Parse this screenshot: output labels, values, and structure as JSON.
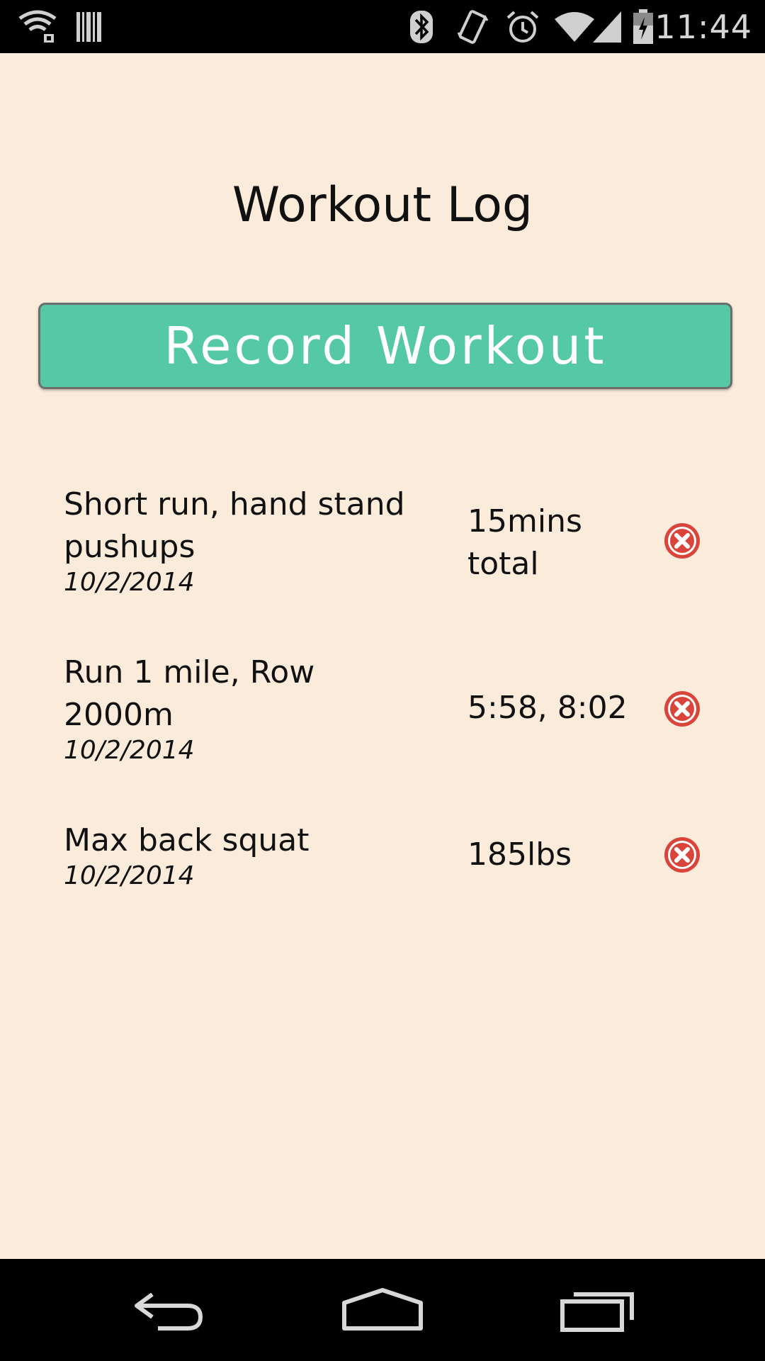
{
  "status_bar": {
    "time": "11:44",
    "icons": [
      "wifi-lock-icon",
      "barcode-icon",
      "bluetooth-icon",
      "vibrate-icon",
      "alarm-icon",
      "wifi-icon",
      "cell-signal-icon",
      "battery-icon"
    ]
  },
  "header": {
    "title": "Workout Log"
  },
  "actions": {
    "record_label": "Record Workout"
  },
  "workouts": [
    {
      "description": "Short run, hand stand pushups",
      "date": "10/2/2014",
      "result": "15mins total"
    },
    {
      "description": "Run 1 mile, Row 2000m",
      "date": "10/2/2014",
      "result": "5:58, 8:02"
    },
    {
      "description": "Max back squat",
      "date": "10/2/2014",
      "result": "185lbs"
    }
  ],
  "nav_bar": {
    "icons": [
      "back-icon",
      "home-icon",
      "recent-apps-icon"
    ]
  },
  "colors": {
    "background": "#faebdb",
    "button_fill": "#55c9a6",
    "delete_red": "#d9453a"
  }
}
